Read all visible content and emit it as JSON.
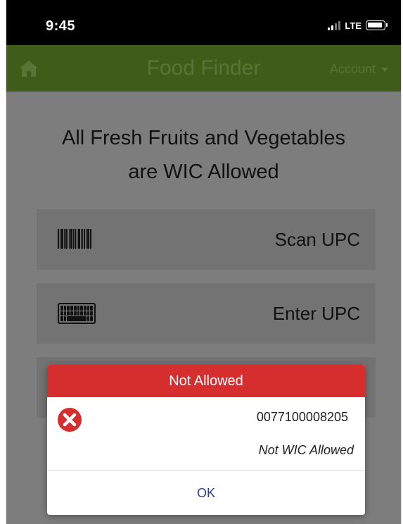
{
  "status_bar": {
    "time": "9:45",
    "network": "LTE"
  },
  "nav": {
    "title": "Food Finder",
    "account_label": "Account",
    "home_icon": "home-icon"
  },
  "main": {
    "headline_line1": "All Fresh Fruits and Vegetables",
    "headline_line2": "are WIC Allowed",
    "actions": [
      {
        "label": "Scan UPC",
        "icon": "barcode-icon"
      },
      {
        "label": "Enter UPC",
        "icon": "keyboard-icon"
      }
    ]
  },
  "modal": {
    "title": "Not Allowed",
    "upc": "0077100008205",
    "message": "Not WIC Allowed",
    "ok_label": "OK",
    "icon": "error-icon"
  },
  "colors": {
    "nav_bar": "#3f5d19",
    "modal_header": "#d62e2e",
    "ok_text": "#2b3d8f"
  }
}
